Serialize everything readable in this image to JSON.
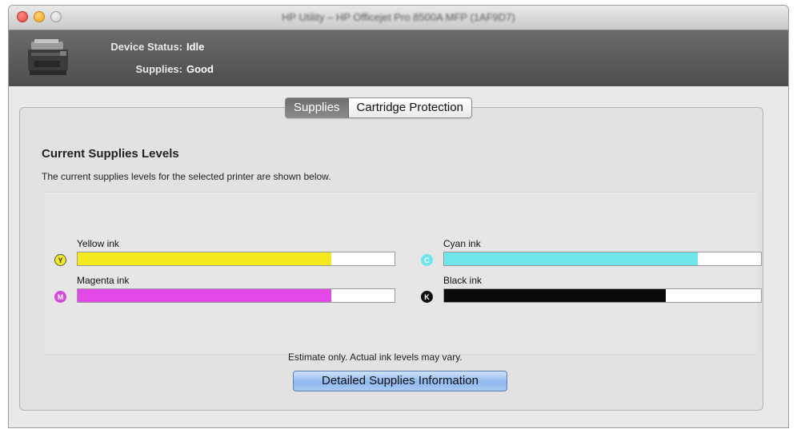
{
  "window": {
    "title": "HP Utility – HP Officejet Pro 8500A MFP (1AF9D7)"
  },
  "header": {
    "device_status_label": "Device Status:",
    "device_status_value": "Idle",
    "supplies_label": "Supplies:",
    "supplies_value": "Good"
  },
  "tabs": [
    {
      "label": "Supplies",
      "active": true
    },
    {
      "label": "Cartridge Protection",
      "active": false
    }
  ],
  "section": {
    "title": "Current Supplies Levels",
    "description": "The current supplies levels for the selected printer are shown below."
  },
  "inks": [
    {
      "label": "Yellow ink",
      "letter": "Y",
      "level": 0.8,
      "color": "#f4e81e",
      "circle_bg": "#f4e81e",
      "circle_fg": "#333333"
    },
    {
      "label": "Cyan ink",
      "letter": "C",
      "level": 0.8,
      "color": "#6ee6ec",
      "circle_bg": "#6ee6ec",
      "circle_fg": "#ffffff"
    },
    {
      "label": "Magenta ink",
      "letter": "M",
      "level": 0.8,
      "color": "#e248e6",
      "circle_bg": "#d44ad8",
      "circle_fg": "#ffffff"
    },
    {
      "label": "Black ink",
      "letter": "K",
      "level": 0.7,
      "color": "#0a0a0a",
      "circle_bg": "#111111",
      "circle_fg": "#ffffff"
    }
  ],
  "estimate_note": "Estimate only. Actual ink levels may vary.",
  "detail_button_label": "Detailed Supplies Information"
}
